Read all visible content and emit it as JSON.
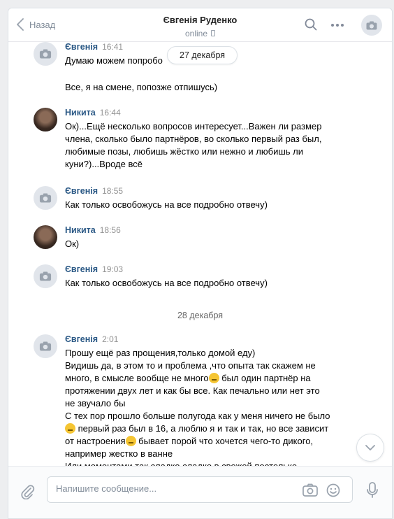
{
  "header": {
    "back_label": "Назад",
    "contact_name": "Євгенія Руденко",
    "status": "online"
  },
  "floating_date": "27 декабря",
  "messages": [
    {
      "author": "Євгенія",
      "time": "16:41",
      "text": "Думаю можем попробо"
    },
    {
      "author": "",
      "time": "",
      "text": "Все, я на смене, попозже отпишусь)"
    },
    {
      "author": "Никита",
      "time": "16:44",
      "text": "Ок)...Ещё несколько вопросов интересует...Важен ли размер\nчлена, сколько было партнёров, во сколько первый раз был,\nлюбимые позы, любишь жёстко или нежно и любишь ли\nкуни?)...Вроде всё"
    },
    {
      "author": "Євгенія",
      "time": "18:55",
      "text": "Как только освобожусь на все подробно отвечу)"
    },
    {
      "author": "Никита",
      "time": "18:56",
      "text": "Ок)"
    },
    {
      "author": "Євгенія",
      "time": "19:03",
      "text": "Как только освобожусь на все подробно отвечу)"
    },
    {
      "author": "Євгенія",
      "time": "2:01",
      "text_parts": [
        "Прошу ещё раз прощения,только домой еду)\nВидишь да, в этом то и проблема ,что опыта так скажем не\nмного, в смысле вообще не много",
        " был один партнёр на\nпротяжении двух лет и как бы все. Как печально или нет это\nне звучало бы\nС тех пор прошло больше полугода как у меня ничего не было\n",
        " первый раз был в 16, а люблю я и так и так, но все зависит\nот настроения",
        " бывает порой что хочется чего-то дикого,\nнапример жестко в ванне\nИли моментами так сладко сладко в свежей постельке"
      ]
    }
  ],
  "day_separator": "28 декабря",
  "composer": {
    "placeholder": "Напишите сообщение..."
  },
  "icons": {
    "back": "chevron-left-icon",
    "search": "search-icon",
    "more": "more-dots-icon",
    "camera": "camera-icon",
    "attach": "paperclip-icon",
    "emoji": "smile-icon",
    "mic": "microphone-icon",
    "scroll_down": "chevron-down-icon"
  },
  "colors": {
    "accent_link": "#2a5885",
    "muted": "#818c99",
    "background": "#edeef0"
  }
}
